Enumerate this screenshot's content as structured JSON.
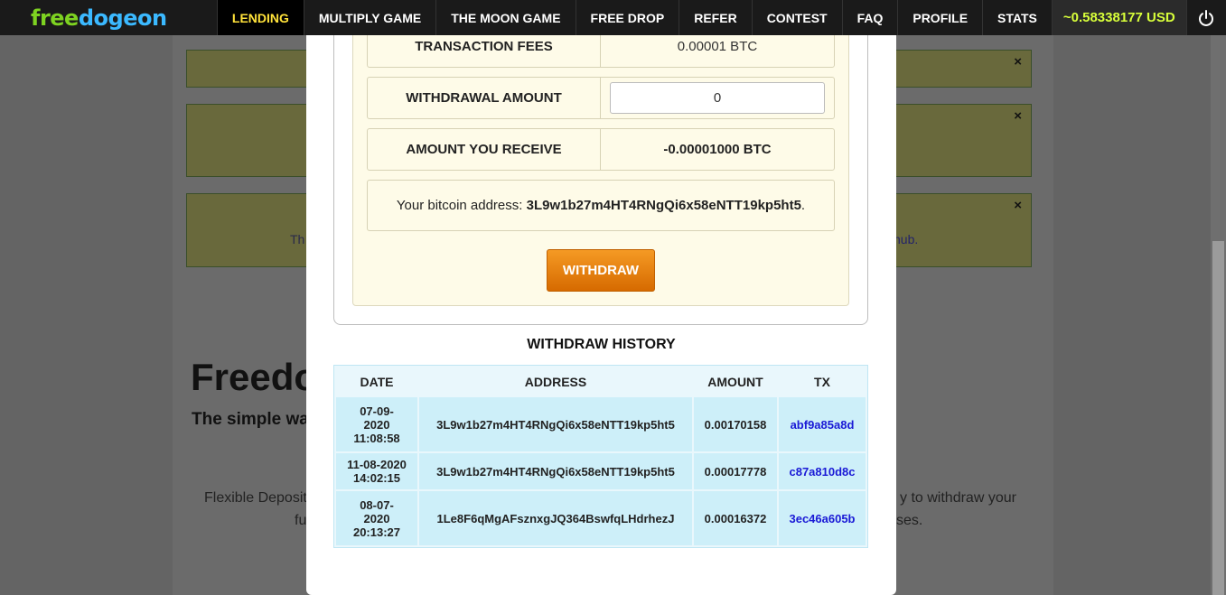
{
  "nav": {
    "logo_part1": "free",
    "logo_part2": "dogeon",
    "items": [
      {
        "label": "LENDING"
      },
      {
        "label": "MULTIPLY GAME"
      },
      {
        "label": "THE MOON GAME"
      },
      {
        "label": "FREE DROP"
      },
      {
        "label": "REFER"
      },
      {
        "label": "CONTEST"
      },
      {
        "label": "FAQ"
      },
      {
        "label": "PROFILE"
      },
      {
        "label": "STATS"
      }
    ],
    "balance": "~0.58338177 USD",
    "power_icon": "power-icon"
  },
  "background": {
    "alert_close": "×",
    "alert_text_left": "Th",
    "alert_text_right": "hub.",
    "hero_title": "Freedo",
    "hero_subtitle": "The simple wa",
    "flex_left": "Flexible Deposit",
    "flex_right": "y to withdraw your",
    "flex_left2": "fu",
    "flex_right2": "ses."
  },
  "withdraw": {
    "fees_label": "TRANSACTION FEES",
    "fees_value": "0.00001 BTC",
    "amount_label": "WITHDRAWAL AMOUNT",
    "amount_value": "0",
    "receive_label": "AMOUNT YOU RECEIVE",
    "receive_value": "-0.00001000 BTC",
    "address_prefix": "Your bitcoin address:",
    "address": "3L9w1b27m4HT4RNgQi6x58eNTT19kp5ht5",
    "address_suffix": ".",
    "button": "WITHDRAW"
  },
  "history": {
    "title": "WITHDRAW HISTORY",
    "columns": [
      "DATE",
      "ADDRESS",
      "AMOUNT",
      "TX"
    ],
    "rows": [
      {
        "date_line1": "07-09-",
        "date_line2": "2020",
        "date_line3": "11:08:58",
        "address": "3L9w1b27m4HT4RNgQi6x58eNTT19kp5ht5",
        "amount": "0.00170158",
        "tx": "abf9a85a8d"
      },
      {
        "date_line1": "11-08-2020",
        "date_line2": "14:02:15",
        "date_line3": "",
        "address": "3L9w1b27m4HT4RNgQi6x58eNTT19kp5ht5",
        "amount": "0.00017778",
        "tx": "c87a810d8c"
      },
      {
        "date_line1": "08-07-",
        "date_line2": "2020",
        "date_line3": "20:13:27",
        "address": "1Le8F6qMgAFsznxgJQ364BswfqLHdrhezJ",
        "amount": "0.00016372",
        "tx": "3ec46a605b"
      }
    ]
  }
}
